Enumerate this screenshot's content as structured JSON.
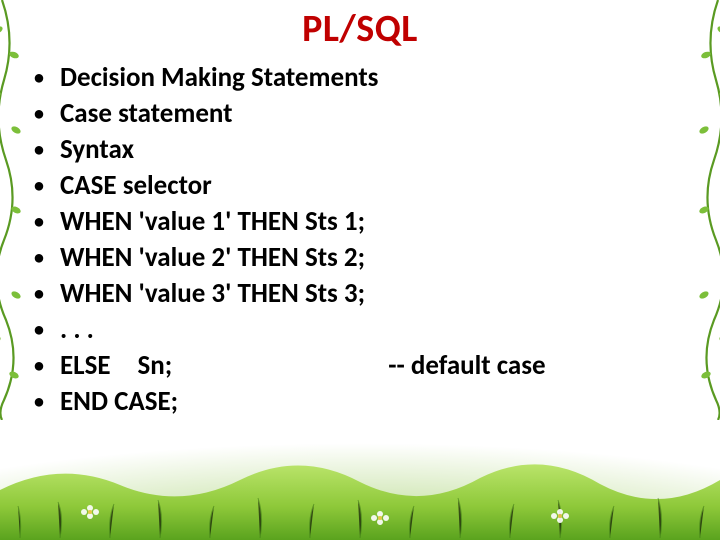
{
  "title": "PL/SQL",
  "bullets": [
    "Decision Making Statements",
    "Case statement",
    "Syntax",
    "CASE selector",
    "WHEN 'value 1' THEN Sts 1;",
    "WHEN 'value 2' THEN Sts 2;",
    "WHEN 'value 3' THEN Sts 3;",
    ". . .",
    "ELSE Sn;        -- default case",
    "END CASE;"
  ],
  "colors": {
    "title": "#c00000",
    "text": "#000000",
    "grass_light": "#9ed34a",
    "grass_dark": "#4e9a1e",
    "vine": "#6fb52a"
  }
}
